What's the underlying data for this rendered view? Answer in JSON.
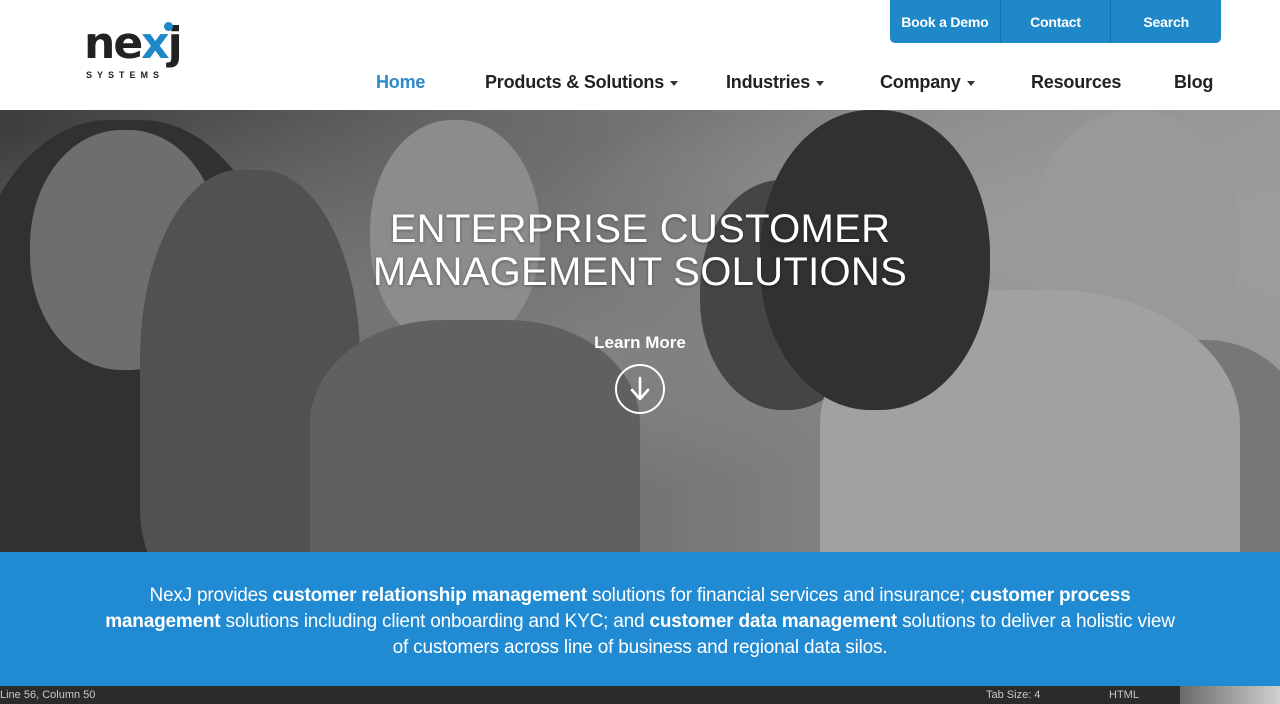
{
  "logo": {
    "wordmark_pre": "ne",
    "wordmark_x": "x",
    "wordmark_post": "j",
    "subtext": "SYSTEMS"
  },
  "utility_nav": [
    {
      "label": "Book a Demo"
    },
    {
      "label": "Contact"
    },
    {
      "label": "Search"
    }
  ],
  "main_nav": [
    {
      "label": "Home",
      "active": true,
      "dropdown": false
    },
    {
      "label": "Products & Solutions",
      "active": false,
      "dropdown": true
    },
    {
      "label": "Industries",
      "active": false,
      "dropdown": true
    },
    {
      "label": "Company",
      "active": false,
      "dropdown": true
    },
    {
      "label": "Resources",
      "active": false,
      "dropdown": false
    },
    {
      "label": "Blog",
      "active": false,
      "dropdown": false
    }
  ],
  "hero": {
    "title_line1": "ENTERPRISE CUSTOMER",
    "title_line2": "MANAGEMENT SOLUTIONS",
    "cta_label": "Learn More",
    "cta_icon": "arrow-down-circle-icon"
  },
  "intro": {
    "t1": "NexJ provides ",
    "b1": "customer relationship management",
    "t2": " solutions for financial services and insurance; ",
    "b2": "customer process management",
    "t3": " solutions including client onboarding and KYC; and ",
    "b3": "customer data management",
    "t4": " solutions to deliver a holistic view of customers across line of business and regional data silos."
  },
  "status_bar": {
    "position": "Line 56, Column 50",
    "tab_size": "Tab Size: 4",
    "language": "HTML"
  },
  "colors": {
    "accent": "#208ad2",
    "nav_active": "#2b8ac7",
    "text": "#222222"
  }
}
